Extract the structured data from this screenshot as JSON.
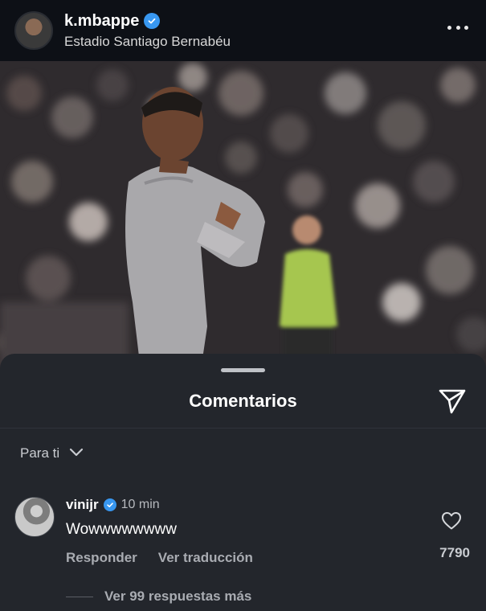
{
  "post": {
    "username": "k.mbappe",
    "location": "Estadio Santiago Bernabéu"
  },
  "comments_sheet": {
    "title": "Comentarios",
    "filter_label": "Para ti"
  },
  "comment": {
    "username": "vinijr",
    "time": "10 min",
    "text": "Wowwwwwwww",
    "reply_label": "Responder",
    "translate_label": "Ver traducción",
    "like_count": "7790",
    "view_replies_label": "Ver 99 respuestas más"
  },
  "icons": {
    "verified": "verified-badge-icon",
    "more": "more-horizontal-icon",
    "share": "share-paper-plane-icon",
    "chevron": "chevron-down-icon",
    "like": "heart-outline-icon"
  },
  "colors": {
    "verified": "#3897f0",
    "sheet_background": "#23262c",
    "header_background": "#0d1016"
  }
}
